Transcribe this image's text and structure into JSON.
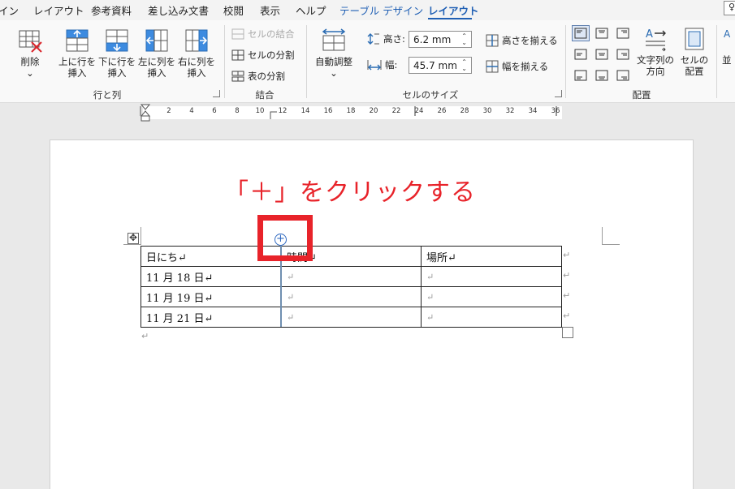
{
  "tabs": [
    "イン",
    "レイアウト",
    "参考資料",
    "差し込み文書",
    "校閲",
    "表示",
    "ヘルプ",
    "テーブル デザイン",
    "レイアウト"
  ],
  "active_tab": "レイアウト",
  "corner_glyph": "♀",
  "ribbon": {
    "rows_cols": {
      "delete": "削除",
      "delete_arrow": "⌄",
      "insert_above": [
        "上に行を",
        "挿入"
      ],
      "insert_below": [
        "下に行を",
        "挿入"
      ],
      "insert_left": [
        "左に列を",
        "挿入"
      ],
      "insert_right": [
        "右に列を",
        "挿入"
      ],
      "label": "行と列"
    },
    "merge": {
      "merge_cells": "セルの結合",
      "split_cells": "セルの分割",
      "split_table": "表の分割",
      "label": "結合"
    },
    "cell_size": {
      "autofit": "自動調整",
      "autofit_arrow": "⌄",
      "height_label": "高さ:",
      "height_value": "6.2 mm",
      "width_label": "幅:",
      "width_value": "45.7 mm",
      "distribute_rows": "高さを揃える",
      "distribute_cols": "幅を揃える",
      "label": "セルのサイズ"
    },
    "alignment": {
      "text_direction": [
        "文字列の",
        "方向"
      ],
      "cell_margins": [
        "セルの",
        "配置"
      ],
      "label": "配置",
      "cut_off": "並"
    }
  },
  "ruler": {
    "numbers": [
      "2",
      "4",
      "6",
      "8",
      "10",
      "12",
      "14",
      "16",
      "18",
      "20",
      "22",
      "24",
      "26",
      "28",
      "30",
      "32",
      "34",
      "36"
    ]
  },
  "document": {
    "instruction": "「＋」をクリックする",
    "plus_glyph": "+",
    "move_glyph": "✥",
    "return_mark": "↵",
    "table": {
      "rows": [
        [
          "日にち↵",
          "時間↵",
          "場所↵"
        ],
        [
          "11 月 18 日↵",
          "↵",
          "↵"
        ],
        [
          "11 月 19 日↵",
          "↵",
          "↵"
        ],
        [
          "11 月 21 日↵",
          "↵",
          "↵"
        ]
      ]
    }
  }
}
